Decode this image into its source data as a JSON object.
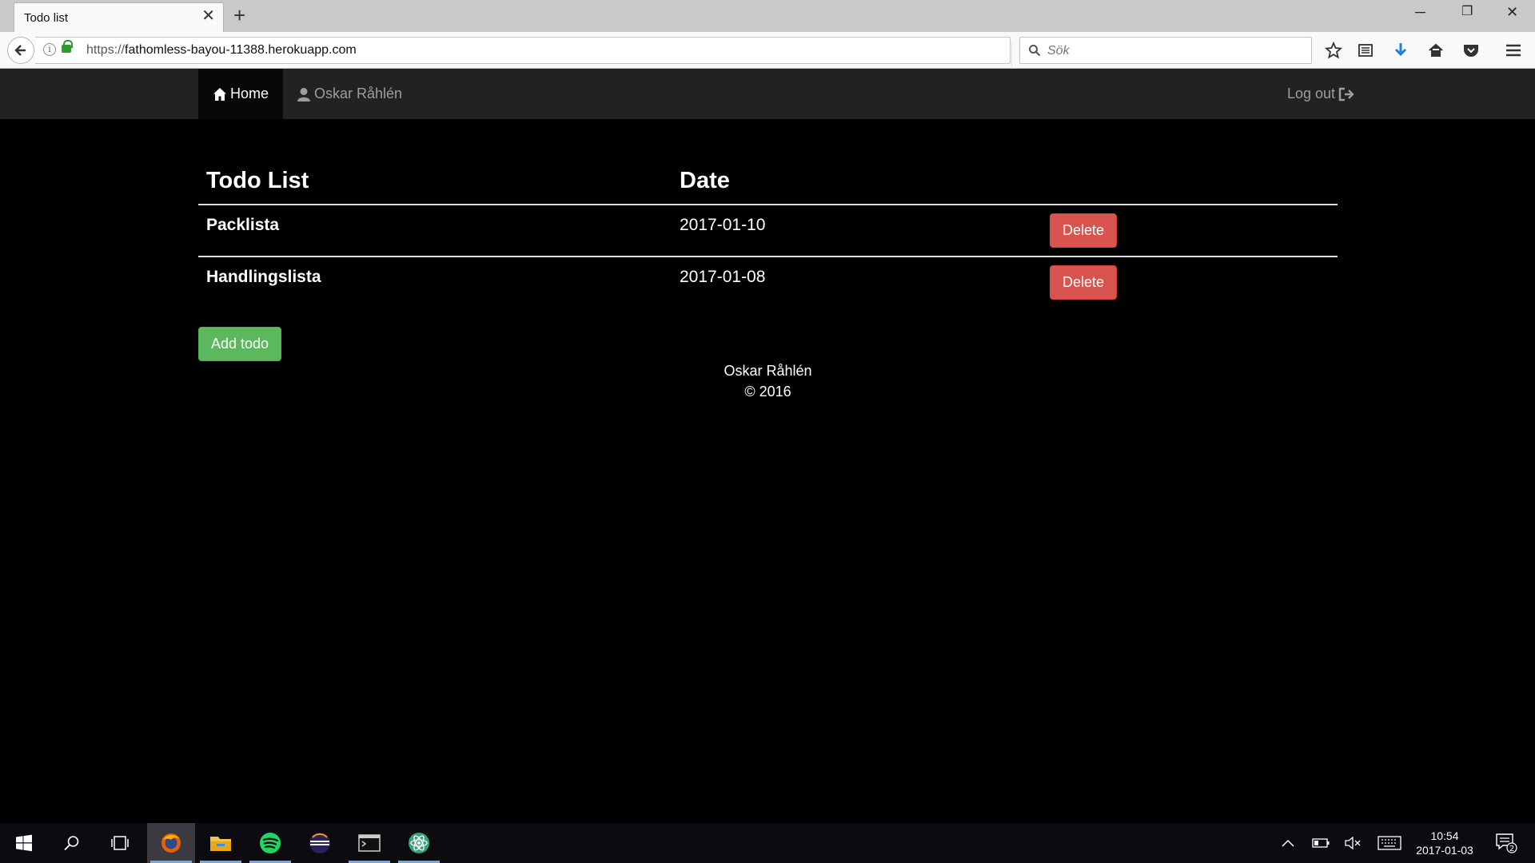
{
  "browser": {
    "tab_title": "Todo list",
    "url_prefix": "https://",
    "url_host": "fathomless-bayou-11388.herokuapp.com",
    "search_placeholder": "Sök"
  },
  "site_nav": {
    "home_label": "Home",
    "user_label": "Oskar Råhlén",
    "logout_label": "Log out"
  },
  "todo_table": {
    "headers": [
      "Todo List",
      "Date"
    ],
    "rows": [
      {
        "name": "Packlista",
        "date": "2017-01-10",
        "action": "Delete"
      },
      {
        "name": "Handlingslista",
        "date": "2017-01-08",
        "action": "Delete"
      }
    ]
  },
  "add_button_label": "Add todo",
  "footer": {
    "author": "Oskar Råhlén",
    "copyright": "© 2016"
  },
  "taskbar": {
    "apps": [
      "windows-start",
      "search",
      "task-view",
      "firefox",
      "file-explorer",
      "spotify",
      "eclipse",
      "terminal",
      "atom"
    ],
    "clock_time": "10:54",
    "clock_date": "2017-01-03",
    "notification_count": "2"
  },
  "colors": {
    "delete_button": "#d9534f",
    "add_button": "#5cb85c",
    "navbar": "#222222",
    "page_background": "#000000"
  }
}
